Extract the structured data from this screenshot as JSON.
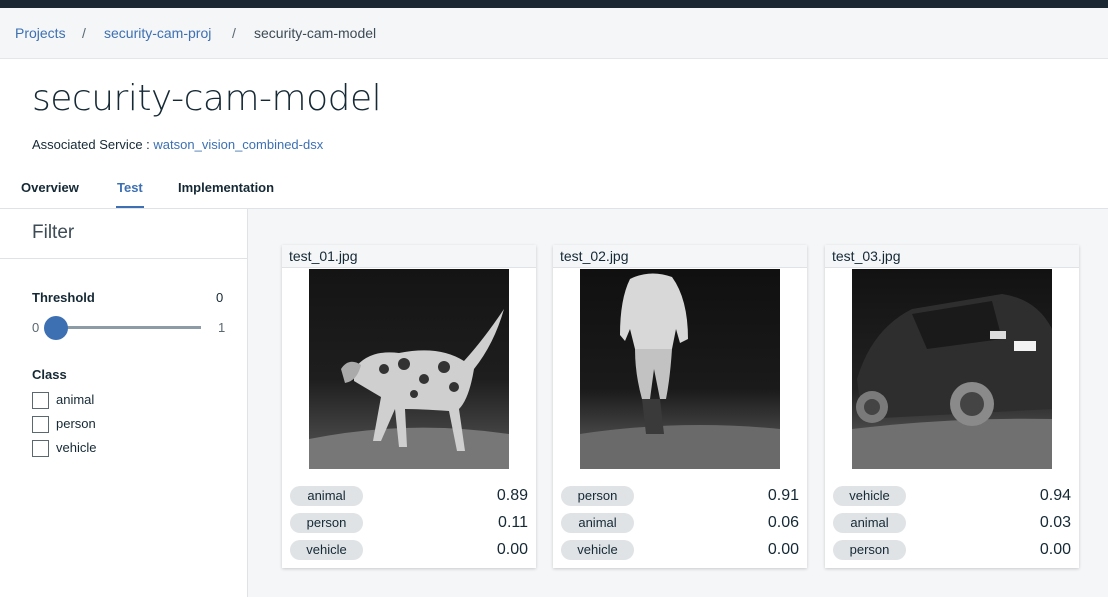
{
  "breadcrumb": {
    "items": [
      "Projects",
      "security-cam-proj"
    ],
    "current": "security-cam-model",
    "separator": "/"
  },
  "page": {
    "title": "security-cam-model",
    "service_label": "Associated Service :",
    "service_link": "watson_vision_combined-dsx"
  },
  "tabs": [
    {
      "label": "Overview",
      "active": false
    },
    {
      "label": "Test",
      "active": true
    },
    {
      "label": "Implementation",
      "active": false
    }
  ],
  "filter": {
    "title": "Filter",
    "threshold_label": "Threshold",
    "threshold_value": "0",
    "slider_min": "0",
    "slider_max": "1",
    "slider_position": 0,
    "class_label": "Class",
    "classes": [
      "animal",
      "person",
      "vehicle"
    ]
  },
  "results": [
    {
      "file": "test_01.jpg",
      "image_icon": "dog-photo",
      "predictions": [
        {
          "label": "animal",
          "score": "0.89"
        },
        {
          "label": "person",
          "score": "0.11"
        },
        {
          "label": "vehicle",
          "score": "0.00"
        }
      ]
    },
    {
      "file": "test_02.jpg",
      "image_icon": "person-photo",
      "predictions": [
        {
          "label": "person",
          "score": "0.91"
        },
        {
          "label": "animal",
          "score": "0.06"
        },
        {
          "label": "vehicle",
          "score": "0.00"
        }
      ]
    },
    {
      "file": "test_03.jpg",
      "image_icon": "vehicle-photo",
      "predictions": [
        {
          "label": "vehicle",
          "score": "0.94"
        },
        {
          "label": "animal",
          "score": "0.03"
        },
        {
          "label": "person",
          "score": "0.00"
        }
      ]
    }
  ],
  "colors": {
    "accent": "#3d70b2",
    "topbar": "#1b2834",
    "pill": "#dfe3e6",
    "panel_bg": "#f4f6f8"
  }
}
